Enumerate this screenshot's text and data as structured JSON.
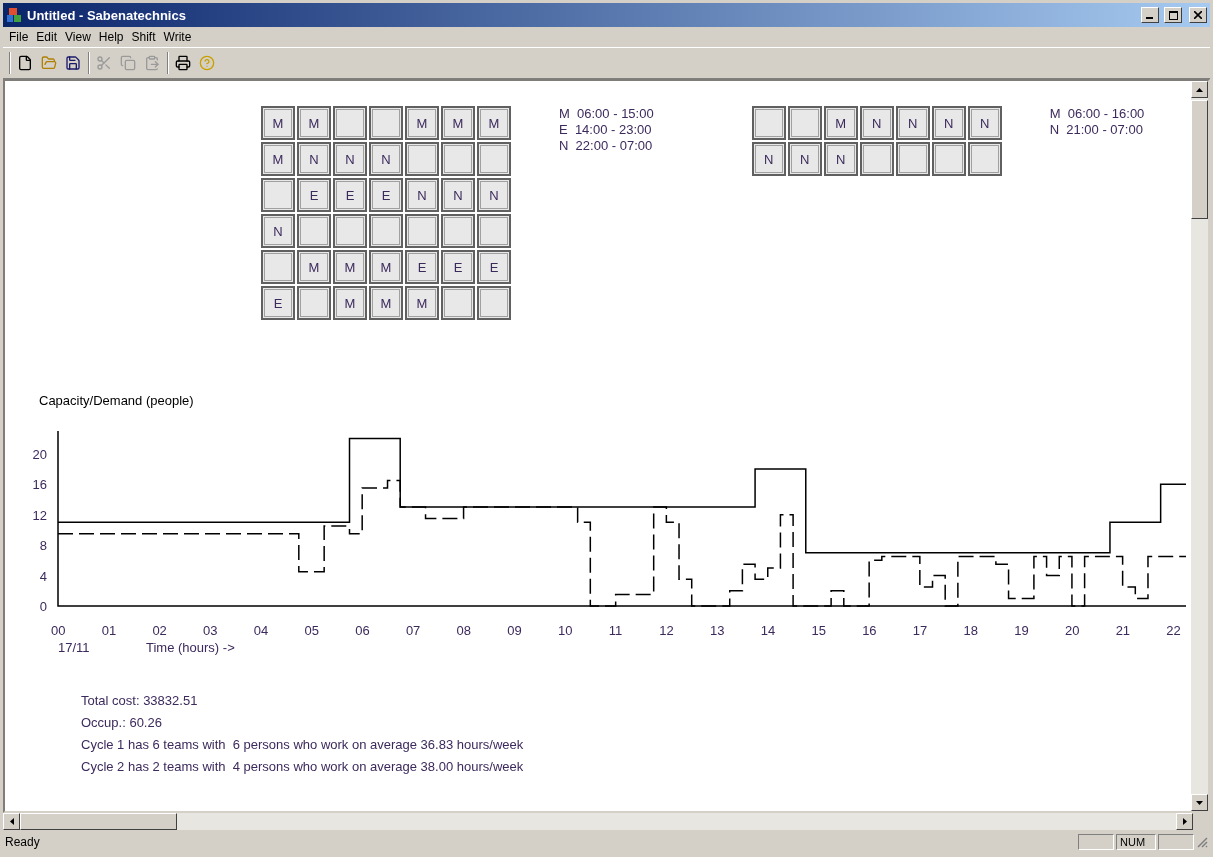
{
  "window": {
    "title": "Untitled - Sabenatechnics"
  },
  "menu": [
    "File",
    "Edit",
    "View",
    "Help",
    "Shift",
    "Write"
  ],
  "toolbar": [
    [
      {
        "kind": "new",
        "disabled": false
      },
      {
        "kind": "open",
        "disabled": false
      },
      {
        "kind": "save",
        "disabled": false
      }
    ],
    [
      {
        "kind": "cut",
        "disabled": true
      },
      {
        "kind": "copy",
        "disabled": true
      },
      {
        "kind": "paste",
        "disabled": true
      }
    ],
    [
      {
        "kind": "print",
        "disabled": false
      },
      {
        "kind": "help",
        "disabled": false
      }
    ]
  ],
  "cycles": [
    {
      "rows": [
        [
          "M",
          "M",
          null,
          null,
          "M",
          "M",
          "M"
        ],
        [
          "M",
          "N",
          "N",
          "N",
          null,
          null,
          null
        ],
        [
          null,
          "E",
          "E",
          "E",
          "N",
          "N",
          "N"
        ],
        [
          "N",
          null,
          null,
          null,
          null,
          null,
          null
        ],
        [
          null,
          "M",
          "M",
          "M",
          "E",
          "E",
          "E"
        ],
        [
          "E",
          null,
          "M",
          "M",
          "M",
          null,
          null
        ]
      ],
      "legend": [
        "M  06:00 - 15:00",
        "E  14:00 - 23:00",
        "N  22:00 - 07:00"
      ]
    },
    {
      "rows": [
        [
          null,
          null,
          "M",
          "N",
          "N",
          "N",
          "N"
        ],
        [
          "N",
          "N",
          "N",
          null,
          null,
          null,
          null
        ]
      ],
      "legend": [
        "M  06:00 - 16:00",
        "N  21:00 - 07:00"
      ]
    }
  ],
  "chart": {
    "date_label": "17/11",
    "chart_data": {
      "type": "line",
      "ylabel": "Capacity/Demand (people)",
      "xlabel": "Time (hours) ->",
      "x": [
        0,
        4.75,
        4.75,
        5.25,
        5.25,
        5.75,
        5.75,
        6,
        6,
        6.5,
        6.5,
        6.75,
        6.75,
        7.25,
        7.25,
        8,
        8,
        10.25,
        10.25,
        10.5,
        10.5,
        11,
        11,
        11.75,
        11.75,
        12,
        12,
        12.25,
        12.25,
        12.5,
        12.5,
        13.25,
        13.25,
        13.5,
        13.5,
        13.75,
        13.75,
        14,
        14,
        14.25,
        14.25,
        14.5,
        14.5,
        14.75,
        14.75,
        15.25,
        15.25,
        15.5,
        15.5,
        16,
        16,
        16.25,
        16.25,
        17,
        17,
        17.25,
        17.25,
        17.5,
        17.5,
        17.75,
        17.75,
        18.5,
        18.5,
        18.75,
        18.75,
        19.25,
        19.25,
        19.5,
        19.5,
        19.75,
        19.75,
        20,
        20,
        20.25,
        20.25,
        20.75,
        20.75,
        21,
        21,
        21.25,
        21.25,
        21.5,
        21.5,
        21.75,
        21.75,
        22.25
      ],
      "xlim": [
        0,
        22.25
      ],
      "ylim": [
        0,
        23
      ],
      "xticks": [
        {
          "value": 0,
          "label": "00"
        },
        {
          "value": 1,
          "label": "01"
        },
        {
          "value": 2,
          "label": "02"
        },
        {
          "value": 3,
          "label": "03"
        },
        {
          "value": 4,
          "label": "04"
        },
        {
          "value": 5,
          "label": "05"
        },
        {
          "value": 6,
          "label": "06"
        },
        {
          "value": 7,
          "label": "07"
        },
        {
          "value": 8,
          "label": "08"
        },
        {
          "value": 9,
          "label": "09"
        },
        {
          "value": 10,
          "label": "10"
        },
        {
          "value": 11,
          "label": "11"
        },
        {
          "value": 12,
          "label": "12"
        },
        {
          "value": 13,
          "label": "13"
        },
        {
          "value": 14,
          "label": "14"
        },
        {
          "value": 15,
          "label": "15"
        },
        {
          "value": 16,
          "label": "16"
        },
        {
          "value": 17,
          "label": "17"
        },
        {
          "value": 18,
          "label": "18"
        },
        {
          "value": 19,
          "label": "19"
        },
        {
          "value": 20,
          "label": "20"
        },
        {
          "value": 21,
          "label": "21"
        },
        {
          "value": 22,
          "label": "22"
        }
      ],
      "yticks": [
        0,
        4,
        8,
        12,
        16,
        20
      ],
      "series": [
        {
          "color": "#000000",
          "line_style": "solid",
          "values": [
            11,
            11,
            11,
            11,
            11,
            11,
            22,
            22,
            22,
            22,
            22,
            22,
            13,
            13,
            13,
            13,
            13,
            13,
            13,
            13,
            13,
            13,
            13,
            13,
            13,
            13,
            13,
            13,
            13,
            13,
            13,
            13,
            13,
            13,
            13,
            13,
            18,
            18,
            18,
            18,
            18,
            18,
            18,
            18,
            7,
            7,
            7,
            7,
            7,
            7,
            7,
            7,
            7,
            7,
            7,
            7,
            7,
            7,
            7,
            7,
            7,
            7,
            7,
            7,
            7,
            7,
            7,
            7,
            7,
            7,
            7,
            7,
            7,
            7,
            7,
            7,
            11,
            11,
            11,
            11,
            11,
            11,
            11,
            11,
            16,
            16
          ]
        },
        {
          "color": "#000000",
          "line_style": "dashed",
          "values": [
            9.5,
            9.5,
            4.5,
            4.5,
            10.5,
            10.5,
            9.5,
            9.5,
            15.5,
            15.5,
            16.5,
            16.5,
            13,
            13,
            11.5,
            11.5,
            13,
            13,
            11,
            11,
            0,
            0,
            1.5,
            1.5,
            13,
            13,
            11,
            11,
            3.5,
            3.5,
            0,
            0,
            2,
            2,
            5.5,
            5.5,
            3.5,
            3.5,
            5,
            5,
            12,
            12,
            0,
            0,
            0,
            0,
            2,
            2,
            0,
            0,
            6,
            6,
            6.5,
            6.5,
            2.5,
            2.5,
            4,
            4,
            0,
            0,
            6.5,
            6.5,
            5.5,
            5.5,
            1,
            1,
            6.5,
            6.5,
            4,
            4,
            6.5,
            6.5,
            0,
            0,
            6.5,
            6.5,
            6.5,
            6.5,
            2.5,
            2.5,
            1,
            1,
            6.5,
            6.5,
            6.5,
            6.5
          ]
        }
      ]
    }
  },
  "stats": [
    "Total cost: 33832.51",
    "Occup.: 60.26",
    "Cycle 1 has 6 teams with  6 persons who work on average 36.83 hours/week",
    "Cycle 2 has 2 teams with  4 persons who work on average 38.00 hours/week"
  ],
  "status_bar": {
    "text": "Ready",
    "indicator": "NUM"
  }
}
